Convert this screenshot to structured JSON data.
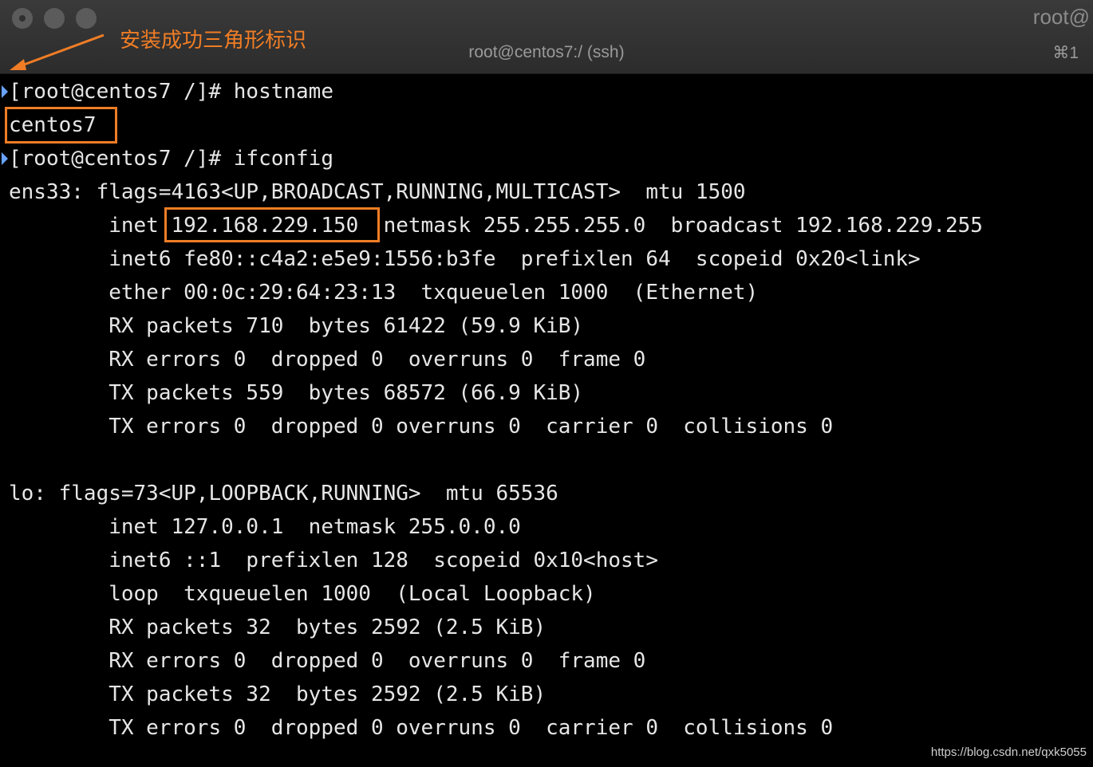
{
  "window": {
    "title": "root@centos7:/ (ssh)",
    "corner_title": "root@",
    "shortcut": "⌘1"
  },
  "annotation": {
    "text": "安装成功三角形标识",
    "color": "#f07d25"
  },
  "terminal": {
    "lines": [
      "[root@centos7 /]# hostname",
      "centos7",
      "[root@centos7 /]# ifconfig",
      "ens33: flags=4163<UP,BROADCAST,RUNNING,MULTICAST>  mtu 1500",
      "        inet 192.168.229.150  netmask 255.255.255.0  broadcast 192.168.229.255",
      "        inet6 fe80::c4a2:e5e9:1556:b3fe  prefixlen 64  scopeid 0x20<link>",
      "        ether 00:0c:29:64:23:13  txqueuelen 1000  (Ethernet)",
      "        RX packets 710  bytes 61422 (59.9 KiB)",
      "        RX errors 0  dropped 0  overruns 0  frame 0",
      "        TX packets 559  bytes 68572 (66.9 KiB)",
      "        TX errors 0  dropped 0 overruns 0  carrier 0  collisions 0",
      "",
      "lo: flags=73<UP,LOOPBACK,RUNNING>  mtu 65536",
      "        inet 127.0.0.1  netmask 255.0.0.0",
      "        inet6 ::1  prefixlen 128  scopeid 0x10<host>",
      "        loop  txqueuelen 1000  (Local Loopback)",
      "        RX packets 32  bytes 2592 (2.5 KiB)",
      "        RX errors 0  dropped 0  overruns 0  frame 0",
      "        TX packets 32  bytes 2592 (2.5 KiB)",
      "        TX errors 0  dropped 0 overruns 0  carrier 0  collisions 0"
    ]
  },
  "watermark": "https://blog.csdn.net/qxk5055",
  "colors": {
    "background": "#000000",
    "text": "#e6e6e6",
    "highlight": "#f07d25",
    "prompt_marker": "#6aa3ff"
  }
}
